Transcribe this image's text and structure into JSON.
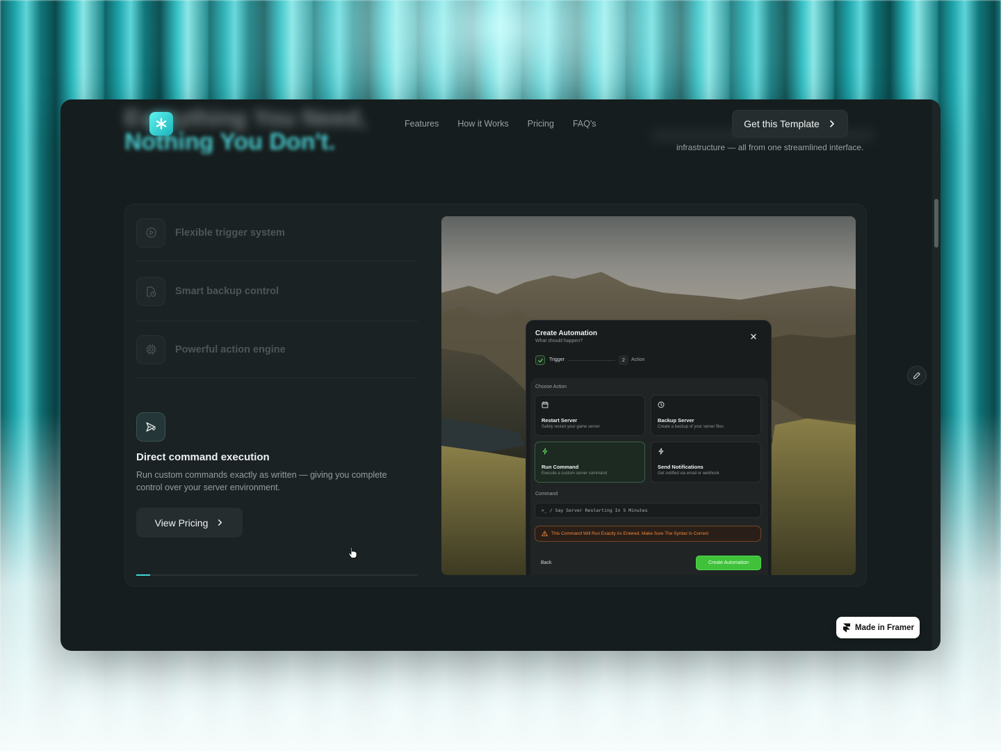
{
  "hero": {
    "line1": "Everything You Need,",
    "line2": "Nothing You Don't.",
    "subtext": "infrastructure — all from one streamlined interface."
  },
  "nav": {
    "logo_icon": "asterisk-icon",
    "links": [
      "Features",
      "How it Works",
      "Pricing",
      "FAQ's"
    ],
    "cta_label": "Get this Template"
  },
  "features": {
    "items": [
      {
        "label": "Flexible trigger system",
        "icon": "play-circle-icon"
      },
      {
        "label": "Smart backup control",
        "icon": "file-clock-icon"
      },
      {
        "label": "Powerful action engine",
        "icon": "cpu-icon"
      }
    ],
    "active": {
      "icon": "send-icon",
      "title": "Direct command execution",
      "description": "Run custom commands exactly as written — giving you complete control over your server environment."
    },
    "pricing_button": "View Pricing",
    "progress": 0.05
  },
  "modal": {
    "title": "Create Automation",
    "subtitle": "What should happen?",
    "steps": [
      {
        "label": "Trigger",
        "state": "done"
      },
      {
        "number": "2",
        "label": "Action",
        "state": "current"
      }
    ],
    "choose_label": "Choose Action",
    "actions": [
      {
        "title": "Restart Server",
        "description": "Safely restart your game server",
        "icon": "calendar-icon",
        "selected": false
      },
      {
        "title": "Backup Server",
        "description": "Create a backup of your server files",
        "icon": "clock-icon",
        "selected": false
      },
      {
        "title": "Run Command",
        "description": "Execute a custom server command",
        "icon": "bolt-icon",
        "selected": true
      },
      {
        "title": "Send Notifications",
        "description": "Get notified via email or webhook",
        "icon": "bolt-icon",
        "selected": false
      }
    ],
    "command_label": "Command",
    "command_value": ">_ / Say Server Restarting In 5 Minutes",
    "warning": "This Command Will Run Exactly As Entered. Make Sure The Syntax Is Correct",
    "back_label": "Back",
    "create_label": "Create Automation"
  },
  "badge": {
    "label": "Made in Framer"
  },
  "colors": {
    "accent": "#3fd7d7",
    "success": "#3fc23a",
    "warning": "#f08a3c",
    "frame_bg": "#161d1e"
  }
}
